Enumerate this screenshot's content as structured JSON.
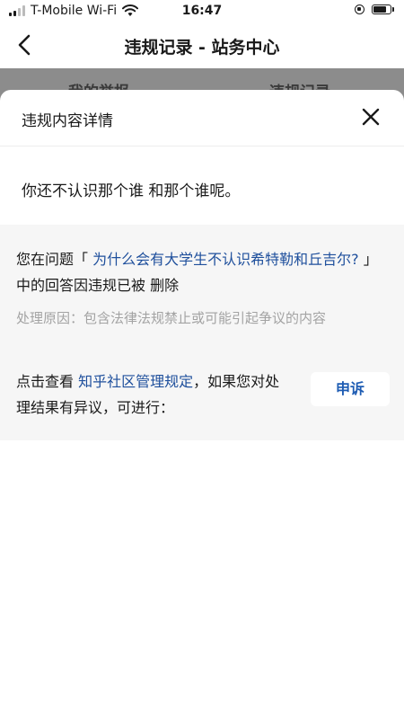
{
  "status_bar": {
    "carrier": "T-Mobile Wi-Fi",
    "time": "16:47"
  },
  "nav": {
    "title": "违规记录 - 站务中心"
  },
  "tabs": [
    {
      "label": "我的举报"
    },
    {
      "label": "违规记录"
    }
  ],
  "sheet": {
    "title": "违规内容详情",
    "content": "你还不认识那个谁 和那个谁呢。",
    "notice": {
      "prefix": "您在问题「",
      "question_link": "为什么会有大学生不认识希特勒和丘吉尔?",
      "middle": "」中的回答因违规已被",
      "action": "删除"
    },
    "reason": "处理原因：包含法律法规禁止或可能引起争议的内容",
    "appeal": {
      "prefix": "点击查看",
      "rules_link": "知乎社区管理规定",
      "suffix": "，如果您对处理结果有异议，可进行：",
      "button_label": "申诉"
    }
  },
  "colors": {
    "link": "#1e4f9c",
    "button_text": "#1e5cb3",
    "panel_bg": "#f6f6f6",
    "overlay": "#8c8c8c"
  }
}
